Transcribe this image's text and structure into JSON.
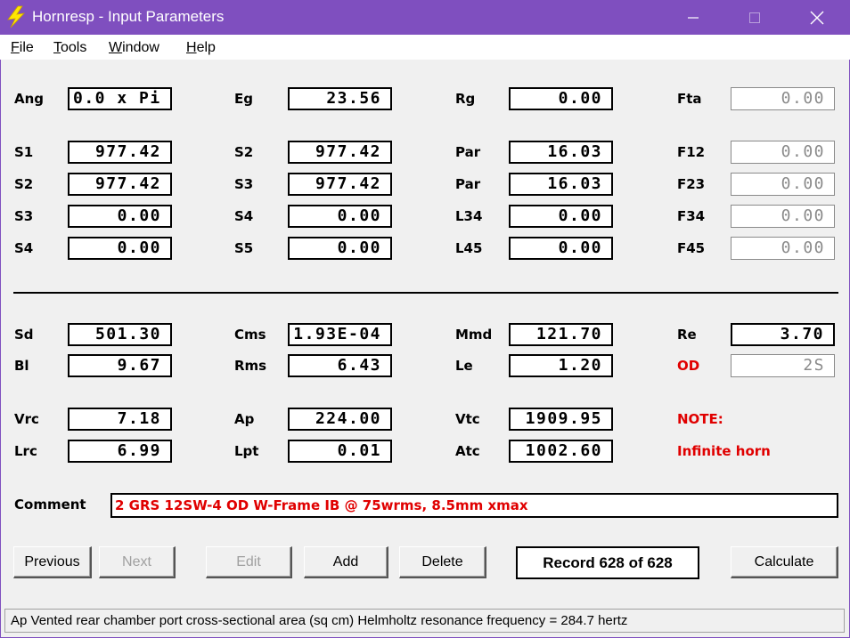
{
  "window": {
    "title": "Hornresp - Input Parameters",
    "title_color": "#7f4fbf",
    "icon": "lightning-bolt-icon",
    "controls": [
      "minimize-icon",
      "maximize-icon",
      "close-icon"
    ]
  },
  "menu": {
    "file": {
      "mnemonic": "F",
      "rest": "ile"
    },
    "tools": {
      "mnemonic": "T",
      "rest": "ools"
    },
    "window": {
      "mnemonic": "W",
      "rest": "indow"
    },
    "help": {
      "mnemonic": "H",
      "rest": "elp"
    }
  },
  "horn": {
    "ang": {
      "label": "Ang",
      "value": "0.0 x Pi"
    },
    "eg": {
      "label": "Eg",
      "value": "23.56"
    },
    "rg": {
      "label": "Rg",
      "value": "0.00"
    },
    "fta": {
      "label": "Fta",
      "value": "0.00"
    },
    "rows": [
      [
        {
          "label": "S1",
          "value": "977.42"
        },
        {
          "label": "S2",
          "value": "977.42"
        },
        {
          "label": "Par",
          "value": "16.03"
        },
        {
          "label": "F12",
          "value": "0.00"
        }
      ],
      [
        {
          "label": "S2",
          "value": "977.42"
        },
        {
          "label": "S3",
          "value": "977.42"
        },
        {
          "label": "Par",
          "value": "16.03"
        },
        {
          "label": "F23",
          "value": "0.00"
        }
      ],
      [
        {
          "label": "S3",
          "value": "0.00"
        },
        {
          "label": "S4",
          "value": "0.00"
        },
        {
          "label": "L34",
          "value": "0.00"
        },
        {
          "label": "F34",
          "value": "0.00"
        }
      ],
      [
        {
          "label": "S4",
          "value": "0.00"
        },
        {
          "label": "S5",
          "value": "0.00"
        },
        {
          "label": "L45",
          "value": "0.00"
        },
        {
          "label": "F45",
          "value": "0.00"
        }
      ]
    ]
  },
  "driver": {
    "sd": {
      "label": "Sd",
      "value": "501.30"
    },
    "cms": {
      "label": "Cms",
      "value": "1.93E-04"
    },
    "mmd": {
      "label": "Mmd",
      "value": "121.70"
    },
    "re": {
      "label": "Re",
      "value": "3.70"
    },
    "bl": {
      "label": "Bl",
      "value": "9.67"
    },
    "rms": {
      "label": "Rms",
      "value": "6.43"
    },
    "le": {
      "label": "Le",
      "value": "1.20"
    },
    "od": {
      "label": "OD",
      "value": "2S"
    }
  },
  "chambers": {
    "vrc": {
      "label": "Vrc",
      "value": "7.18"
    },
    "ap": {
      "label": "Ap",
      "value": "224.00"
    },
    "vtc": {
      "label": "Vtc",
      "value": "1909.95"
    },
    "lrc": {
      "label": "Lrc",
      "value": "6.99"
    },
    "lpt": {
      "label": "Lpt",
      "value": "0.01"
    },
    "atc": {
      "label": "Atc",
      "value": "1002.60"
    },
    "note_label": "NOTE:",
    "note_text": "Infinite horn"
  },
  "comment": {
    "label": "Comment",
    "value": "2 GRS 12SW-4 OD W-Frame IB @ 75wrms, 8.5mm xmax"
  },
  "buttons": {
    "previous": "Previous",
    "next": "Next",
    "edit": "Edit",
    "add": "Add",
    "delete": "Delete",
    "record": "Record 628 of 628",
    "calculate": "Calculate"
  },
  "status": "Ap   Vented rear chamber port cross-sectional area  (sq cm)   Helmholtz resonance frequency = 284.7 hertz",
  "colors": {
    "accent": "#7f4fbf",
    "warning": "#e00000"
  }
}
